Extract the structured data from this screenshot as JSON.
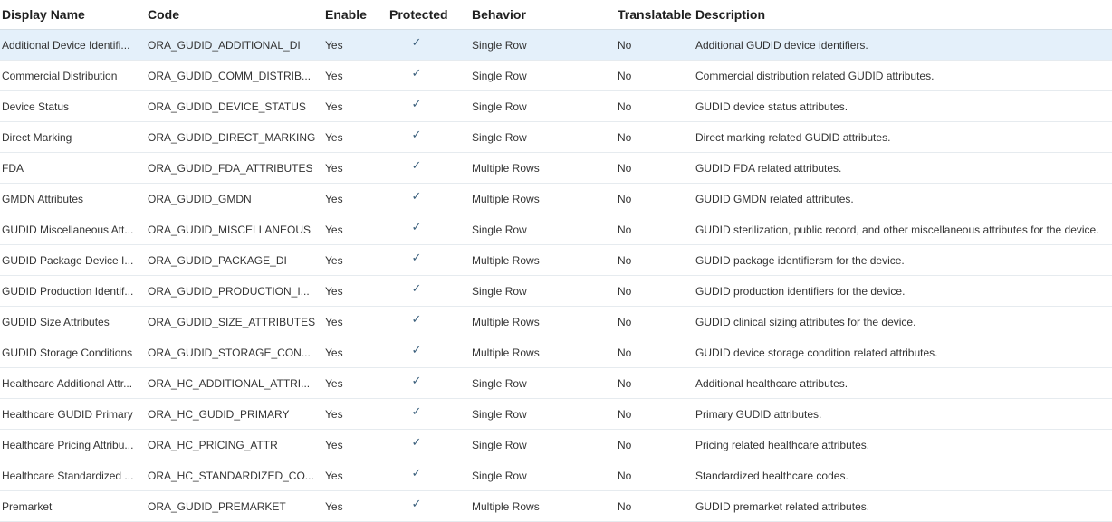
{
  "columns": {
    "display_name": "Display Name",
    "code": "Code",
    "enable": "Enable",
    "protected": "Protected",
    "behavior": "Behavior",
    "translatable": "Translatable",
    "description": "Description"
  },
  "icons": {
    "protected_check": "checkmark-icon"
  },
  "colors": {
    "selected_row": "#e4f0fa",
    "check": "#3b5f7c",
    "header_border": "#d6dfe6"
  },
  "rows": [
    {
      "name": "Additional Device Identifi...",
      "code": "ORA_GUDID_ADDITIONAL_DI",
      "enable": "Yes",
      "protected": "✓",
      "behavior": "Single Row",
      "translatable": "No",
      "description": "Additional GUDID device identifiers."
    },
    {
      "name": "Commercial Distribution",
      "code": "ORA_GUDID_COMM_DISTRIB...",
      "enable": "Yes",
      "protected": "✓",
      "behavior": "Single Row",
      "translatable": "No",
      "description": "Commercial distribution related GUDID attributes."
    },
    {
      "name": "Device Status",
      "code": "ORA_GUDID_DEVICE_STATUS",
      "enable": "Yes",
      "protected": "✓",
      "behavior": "Single Row",
      "translatable": "No",
      "description": "GUDID device status attributes."
    },
    {
      "name": "Direct Marking",
      "code": "ORA_GUDID_DIRECT_MARKING",
      "enable": "Yes",
      "protected": "✓",
      "behavior": "Single Row",
      "translatable": "No",
      "description": "Direct marking related GUDID attributes."
    },
    {
      "name": "FDA",
      "code": "ORA_GUDID_FDA_ATTRIBUTES",
      "enable": "Yes",
      "protected": "✓",
      "behavior": "Multiple Rows",
      "translatable": "No",
      "description": "GUDID FDA related attributes."
    },
    {
      "name": "GMDN Attributes",
      "code": "ORA_GUDID_GMDN",
      "enable": "Yes",
      "protected": "✓",
      "behavior": "Multiple Rows",
      "translatable": "No",
      "description": "GUDID GMDN related attributes."
    },
    {
      "name": "GUDID Miscellaneous Att...",
      "code": "ORA_GUDID_MISCELLANEOUS",
      "enable": "Yes",
      "protected": "✓",
      "behavior": "Single Row",
      "translatable": "No",
      "description": "GUDID sterilization, public record, and other miscellaneous attributes for the device."
    },
    {
      "name": "GUDID Package Device I...",
      "code": "ORA_GUDID_PACKAGE_DI",
      "enable": "Yes",
      "protected": "✓",
      "behavior": "Multiple Rows",
      "translatable": "No",
      "description": "GUDID package identifiersm for the device."
    },
    {
      "name": "GUDID Production Identif...",
      "code": "ORA_GUDID_PRODUCTION_I...",
      "enable": "Yes",
      "protected": "✓",
      "behavior": "Single Row",
      "translatable": "No",
      "description": "GUDID production identifiers for the device."
    },
    {
      "name": "GUDID Size Attributes",
      "code": "ORA_GUDID_SIZE_ATTRIBUTES",
      "enable": "Yes",
      "protected": "✓",
      "behavior": "Multiple Rows",
      "translatable": "No",
      "description": "GUDID clinical sizing attributes for the device."
    },
    {
      "name": "GUDID Storage Conditions",
      "code": "ORA_GUDID_STORAGE_CON...",
      "enable": "Yes",
      "protected": "✓",
      "behavior": "Multiple Rows",
      "translatable": "No",
      "description": "GUDID device storage condition related attributes."
    },
    {
      "name": "Healthcare Additional Attr...",
      "code": "ORA_HC_ADDITIONAL_ATTRI...",
      "enable": "Yes",
      "protected": "✓",
      "behavior": "Single Row",
      "translatable": "No",
      "description": "Additional healthcare attributes."
    },
    {
      "name": "Healthcare GUDID Primary",
      "code": "ORA_HC_GUDID_PRIMARY",
      "enable": "Yes",
      "protected": "✓",
      "behavior": "Single Row",
      "translatable": "No",
      "description": "Primary GUDID attributes."
    },
    {
      "name": "Healthcare Pricing Attribu...",
      "code": "ORA_HC_PRICING_ATTR",
      "enable": "Yes",
      "protected": "✓",
      "behavior": "Single Row",
      "translatable": "No",
      "description": "Pricing related healthcare attributes."
    },
    {
      "name": "Healthcare Standardized ...",
      "code": "ORA_HC_STANDARDIZED_CO...",
      "enable": "Yes",
      "protected": "✓",
      "behavior": "Single Row",
      "translatable": "No",
      "description": "Standardized healthcare codes."
    },
    {
      "name": "Premarket",
      "code": "ORA_GUDID_PREMARKET",
      "enable": "Yes",
      "protected": "✓",
      "behavior": "Multiple Rows",
      "translatable": "No",
      "description": "GUDID premarket related attributes."
    }
  ]
}
